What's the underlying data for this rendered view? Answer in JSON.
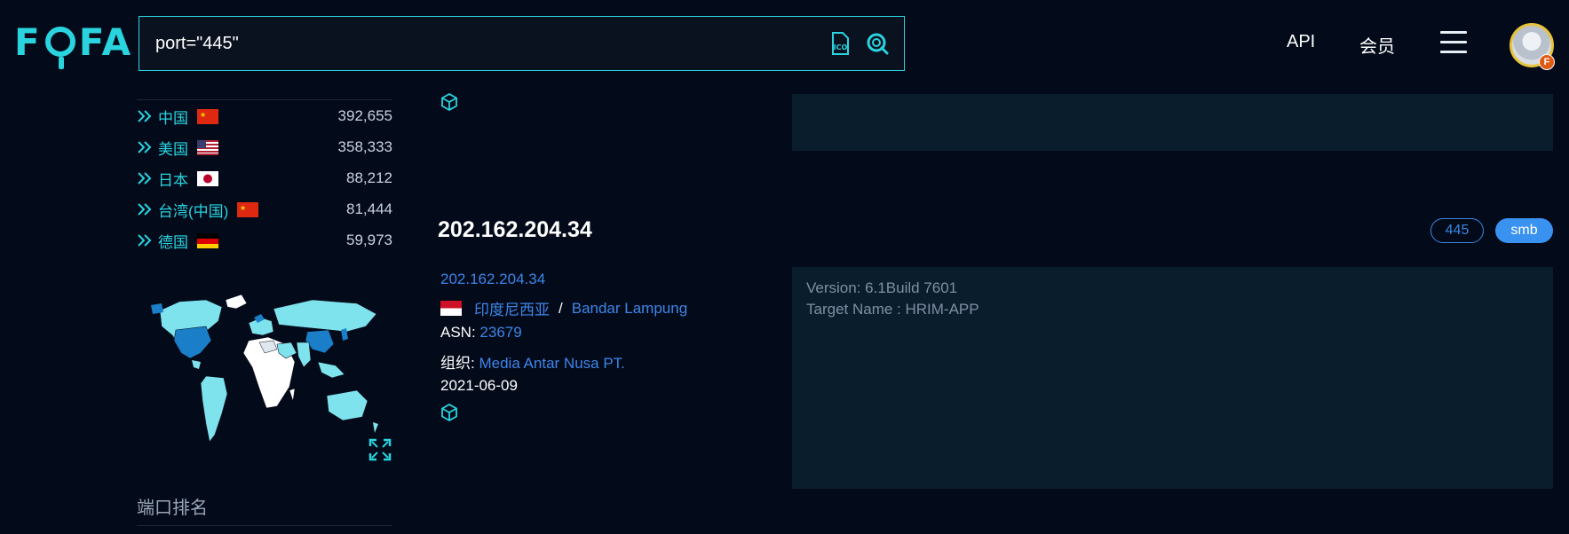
{
  "header": {
    "logo": "FOFA",
    "search_value": "port=\"445\"",
    "nav_api": "API",
    "nav_member": "会员",
    "avatar_badge": "F"
  },
  "sidebar": {
    "countries": [
      {
        "name": "中国",
        "flag": "cn",
        "count": "392,655"
      },
      {
        "name": "美国",
        "flag": "us",
        "count": "358,333"
      },
      {
        "name": "日本",
        "flag": "jp",
        "count": "88,212"
      },
      {
        "name": "台湾(中国)",
        "flag": "cn",
        "count": "81,444"
      },
      {
        "name": "德国",
        "flag": "de",
        "count": "59,973"
      }
    ],
    "port_rank_title": "端口排名"
  },
  "result": {
    "ip_title": "202.162.204.34",
    "ip_link": "202.162.204.34",
    "country": "印度尼西亚",
    "country_flag": "id",
    "separator": "/",
    "city": "Bandar Lampung",
    "asn_label": "ASN:",
    "asn_value": "23679",
    "org_label": "组织:",
    "org_value": "Media Antar Nusa PT.",
    "date": "2021-06-09",
    "tags": {
      "port": "445",
      "protocol": "smb"
    },
    "banner_lines": [
      "Version: 6.1Build 7601",
      "Target Name : HRIM-APP"
    ]
  },
  "colors": {
    "background": "#030a1a",
    "accent_cyan": "#2ad4df",
    "link_blue": "#3d86e8",
    "banner_bg": "#0a1d2c"
  }
}
